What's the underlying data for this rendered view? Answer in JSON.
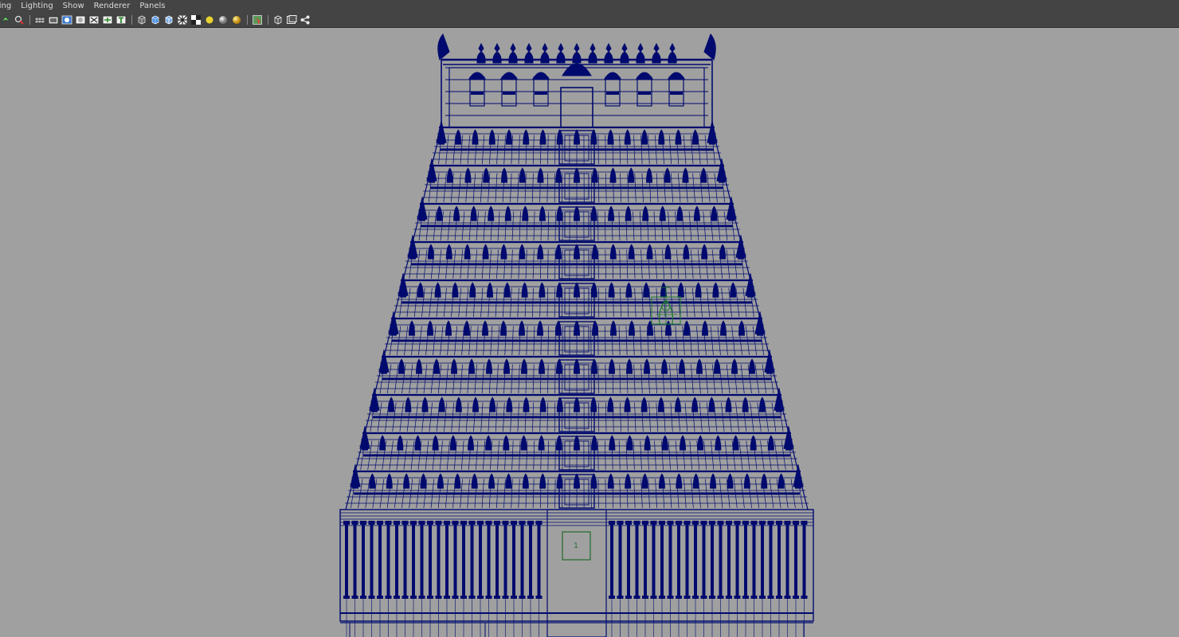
{
  "menubar": {
    "items": [
      "ling",
      "Lighting",
      "Show",
      "Renderer",
      "Panels"
    ]
  },
  "toolbar": {
    "icons": [
      "camera-select-icon",
      "camera-attributes-icon",
      "grid-icon",
      "film-gate-icon",
      "resolution-gate-icon",
      "field-chart-icon",
      "safe-action-icon",
      "safe-title-icon",
      "text-icon",
      "wireframe-icon",
      "smooth-shade-icon",
      "flat-shade-icon",
      "wireframe-on-shaded-icon",
      "textured-icon",
      "default-light-icon",
      "shadows-icon",
      "isolate-select-icon",
      "xray-icon",
      "xray-joints-icon",
      "hypershade-icon"
    ]
  },
  "viewport": {
    "wire_color": "#000a6e",
    "selected_color": "#1d7a2e",
    "background_color": "#a0a0a0",
    "pivot_label": "1"
  }
}
